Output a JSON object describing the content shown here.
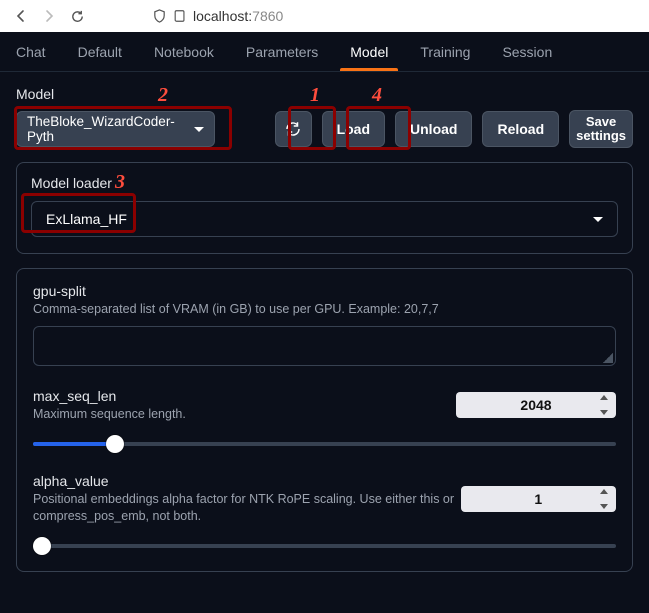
{
  "chrome": {
    "url_host": "localhost:",
    "url_port": "7860"
  },
  "tabs": {
    "items": [
      "Chat",
      "Default",
      "Notebook",
      "Parameters",
      "Model",
      "Training",
      "Session"
    ],
    "active_index": 4
  },
  "model_section": {
    "label": "Model",
    "selected": "TheBloke_WizardCoder-Pyth",
    "refresh_icon": "refresh-icon",
    "buttons": {
      "load": "Load",
      "unload": "Unload",
      "reload": "Reload",
      "save_settings_line1": "Save",
      "save_settings_line2": "settings"
    }
  },
  "loader_panel": {
    "title": "Model loader",
    "selected": "ExLlama_HF"
  },
  "settings": {
    "gpu_split": {
      "label": "gpu-split",
      "help": "Comma-separated list of VRAM (in GB) to use per GPU. Example: 20,7,7",
      "value": ""
    },
    "max_seq_len": {
      "label": "max_seq_len",
      "help": "Maximum sequence length.",
      "value": "2048",
      "slider_percent": 14
    },
    "alpha_value": {
      "label": "alpha_value",
      "help": "Positional embeddings alpha factor for NTK RoPE scaling. Use either this or compress_pos_emb, not both.",
      "value": "1",
      "slider_percent": 0
    }
  },
  "annotations": {
    "n1": "1",
    "n2": "2",
    "n3": "3",
    "n4": "4"
  }
}
